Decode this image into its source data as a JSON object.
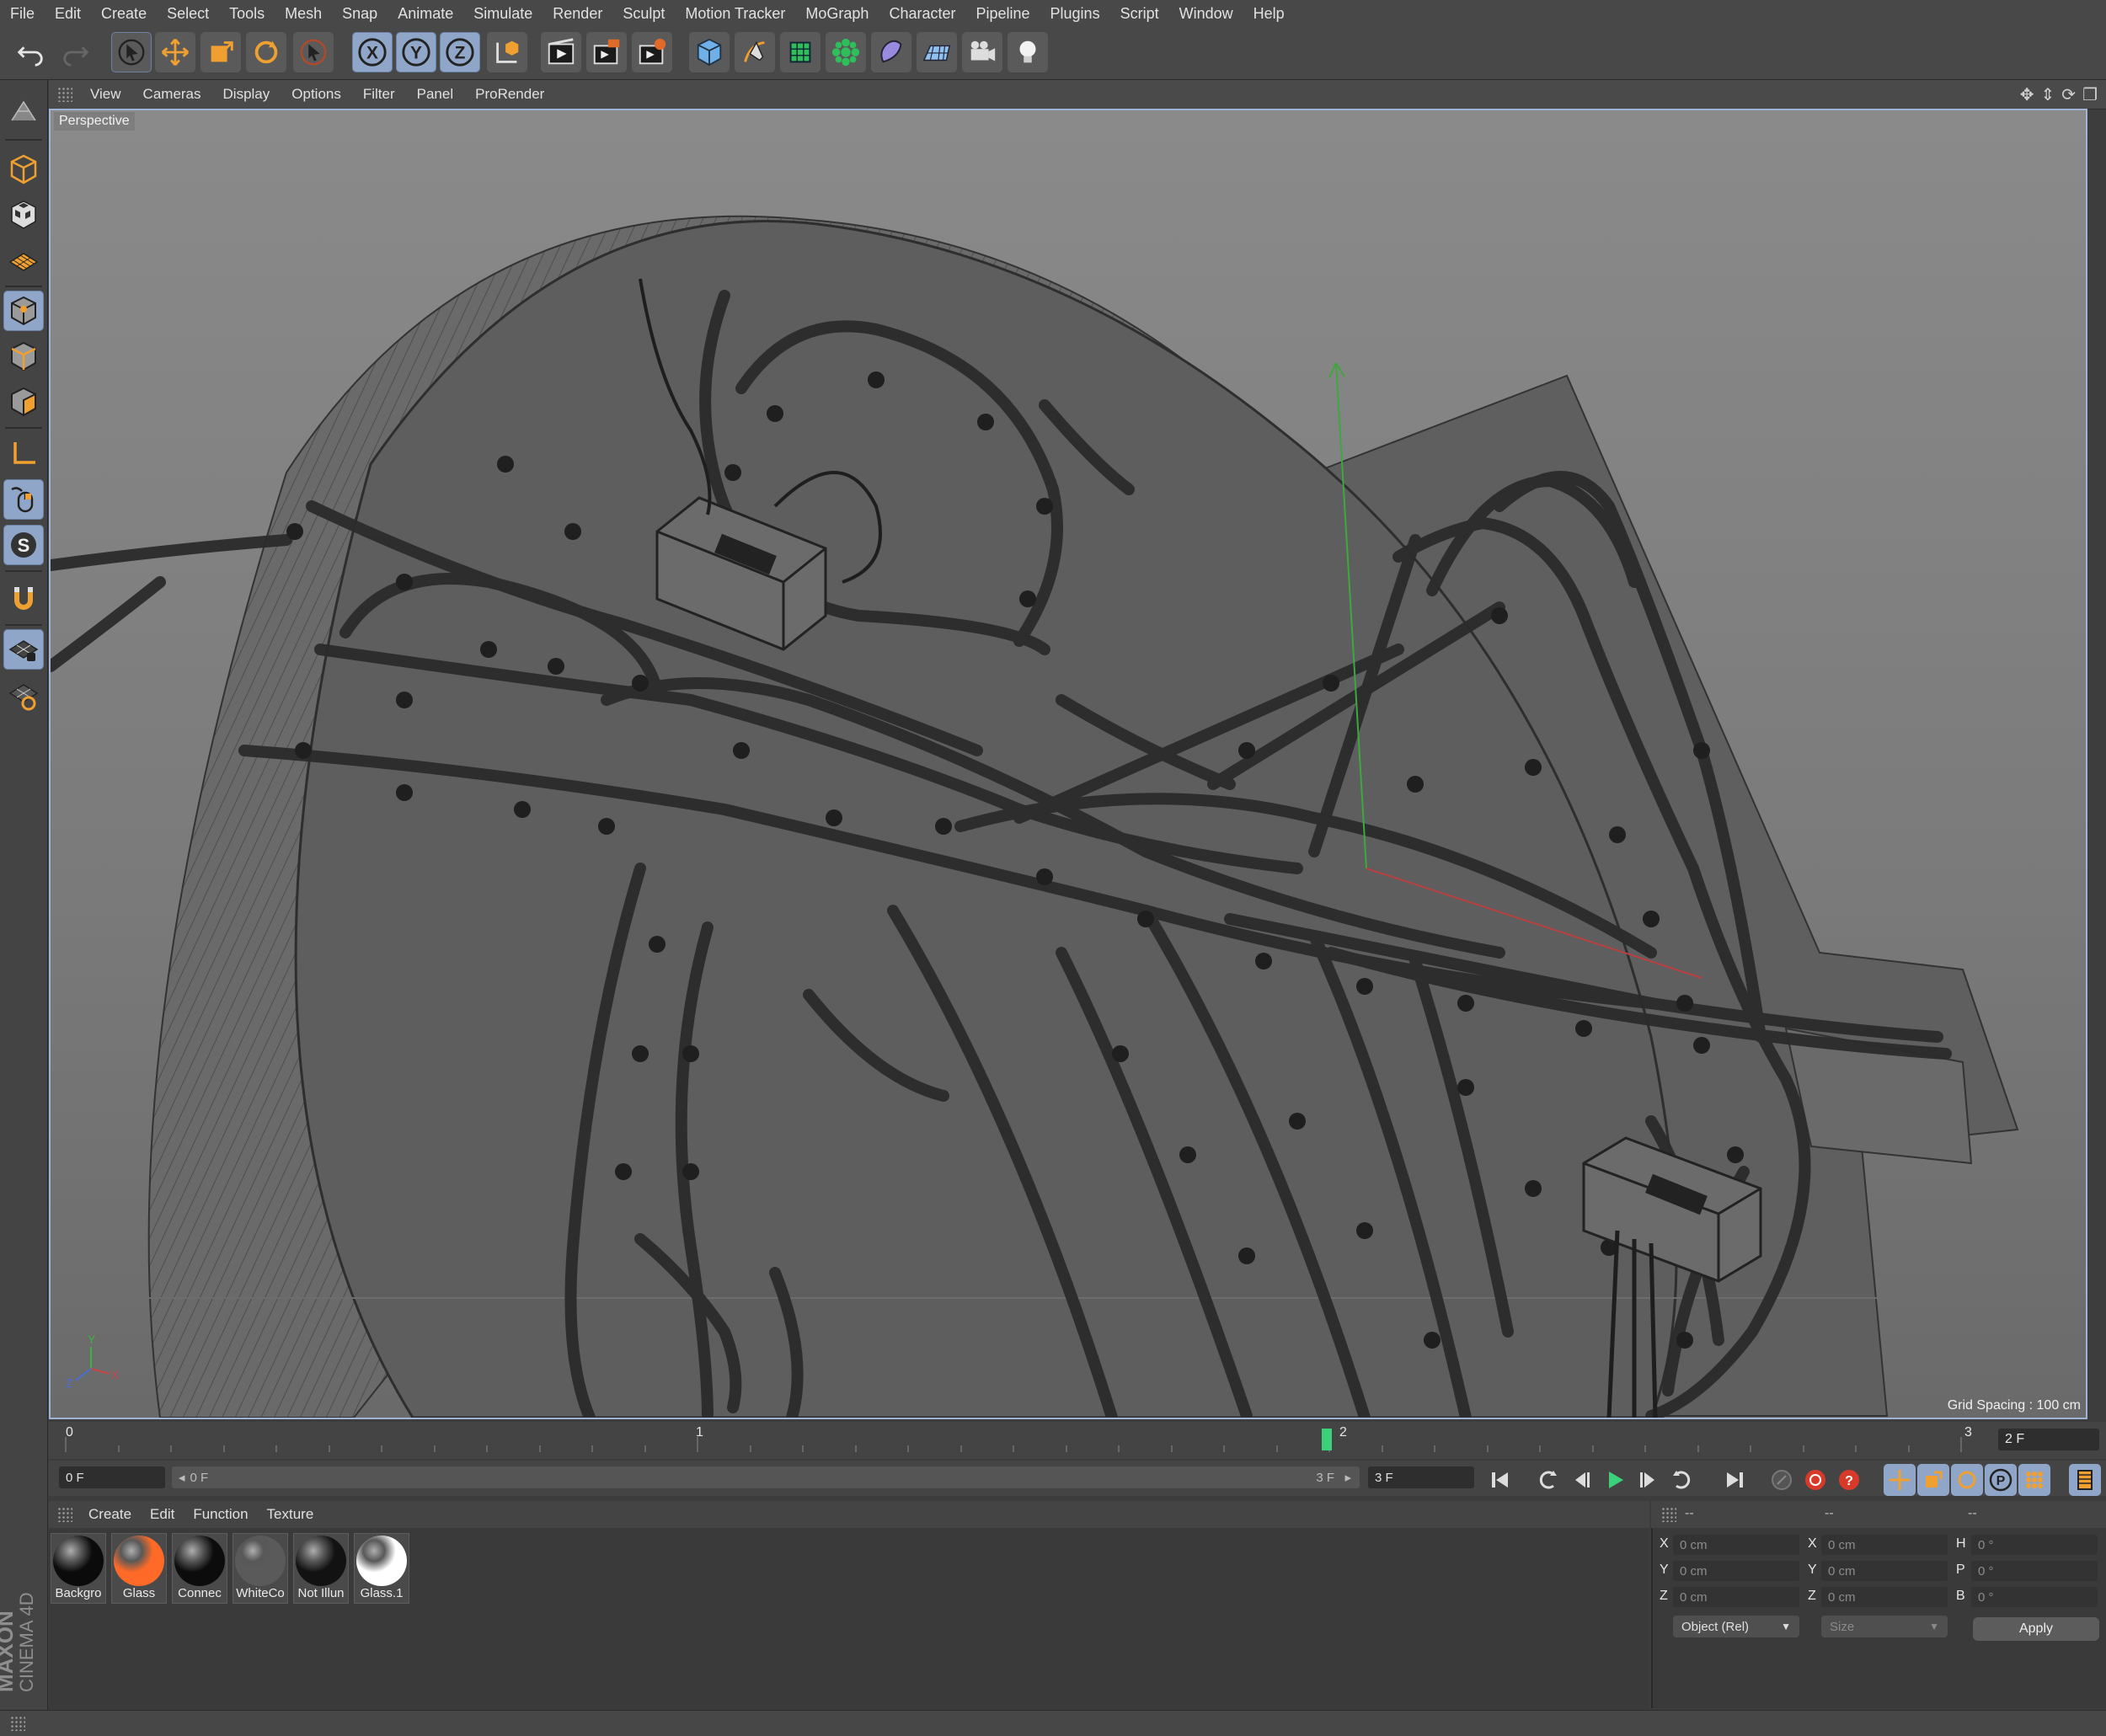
{
  "menu": [
    "File",
    "Edit",
    "Create",
    "Select",
    "Tools",
    "Mesh",
    "Snap",
    "Animate",
    "Simulate",
    "Render",
    "Sculpt",
    "Motion Tracker",
    "MoGraph",
    "Character",
    "Pipeline",
    "Plugins",
    "Script",
    "Window",
    "Help"
  ],
  "toolbar": {
    "axis_x": "X",
    "axis_y": "Y",
    "axis_z": "Z",
    "icons": [
      "undo-icon",
      "redo-icon",
      "live-selection-icon",
      "move-icon",
      "scale-icon",
      "rotate-icon",
      "recent-tool-icon",
      "x-axis-icon",
      "y-axis-icon",
      "z-axis-icon",
      "coordinate-system-icon",
      "render-view-icon",
      "render-picture-viewer-icon",
      "edit-render-settings-icon",
      "cube-icon",
      "pen-icon",
      "subdivision-surface-icon",
      "cloner-icon",
      "deformer-icon",
      "floor-icon",
      "camera-icon",
      "light-icon"
    ]
  },
  "left_palette": [
    "make-editable-icon",
    "model-mode-icon",
    "texture-mode-icon",
    "workplane-mode-icon",
    "points-mode-icon",
    "edges-mode-icon",
    "polygons-mode-icon",
    "axis-mode-icon",
    "tweak-mode-icon",
    "solo-icon",
    "magnet-icon",
    "snap-grid-icon",
    "snap-settings-icon"
  ],
  "viewport": {
    "menu": [
      "View",
      "Cameras",
      "Display",
      "Options",
      "Filter",
      "Panel",
      "ProRender"
    ],
    "label": "Perspective",
    "grid_spacing": "Grid Spacing : 100 cm",
    "axis_y": "Y",
    "axis_z": "Z",
    "axis_x": "X"
  },
  "timeline": {
    "ticks": [
      "0",
      "1",
      "2",
      "3"
    ],
    "current_frame_fraction": 0.666,
    "end_field": "2 F"
  },
  "transport": {
    "start_field": "0 F",
    "range_start": "0 F",
    "range_end": "3 F",
    "end_field": "3 F"
  },
  "materials": {
    "menu": [
      "Create",
      "Edit",
      "Function",
      "Texture"
    ],
    "items": [
      {
        "name": "Backgro",
        "color": "#0b0b0b"
      },
      {
        "name": "Glass",
        "color": "#ff6a28"
      },
      {
        "name": "Connec",
        "color": "#0c0c0c"
      },
      {
        "name": "WhiteCo",
        "color": "#5a5a5a"
      },
      {
        "name": "Not Illun",
        "color": "#121212"
      },
      {
        "name": "Glass.1",
        "color": "#ffffff"
      }
    ]
  },
  "coordinates": {
    "headers": [
      "--",
      "--",
      "--"
    ],
    "rows": [
      {
        "l1": "X",
        "v1": "0 cm",
        "l2": "X",
        "v2": "0 cm",
        "l3": "H",
        "v3": "0 °"
      },
      {
        "l1": "Y",
        "v1": "0 cm",
        "l2": "Y",
        "v2": "0 cm",
        "l3": "P",
        "v3": "0 °"
      },
      {
        "l1": "Z",
        "v1": "0 cm",
        "l2": "Z",
        "v2": "0 cm",
        "l3": "B",
        "v3": "0 °"
      }
    ],
    "mode": "Object (Rel)",
    "size_mode": "Size",
    "apply": "Apply"
  },
  "brand": {
    "line1": "MAXON",
    "line2": "CINEMA 4D"
  },
  "colors": {
    "accent": "#8fa6c8",
    "orange": "#f0a030",
    "material_orange": "#ff6a28",
    "playhead": "#3bd07a"
  }
}
